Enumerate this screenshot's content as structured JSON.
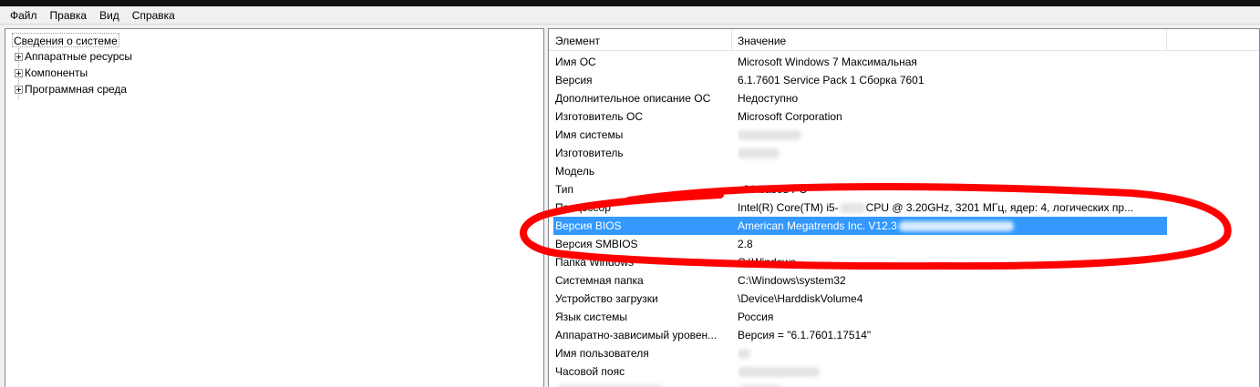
{
  "menu": {
    "file": "Файл",
    "edit": "Правка",
    "view": "Вид",
    "help": "Справка"
  },
  "tree": {
    "root": "Сведения о системе",
    "children": [
      "Аппаратные ресурсы",
      "Компоненты",
      "Программная среда"
    ]
  },
  "list": {
    "headers": {
      "item": "Элемент",
      "value": "Значение"
    },
    "rows": [
      {
        "item": "Имя ОС",
        "value": "Microsoft Windows 7 Максимальная"
      },
      {
        "item": "Версия",
        "value": "6.1.7601 Service Pack 1 Сборка 7601"
      },
      {
        "item": "Дополнительное описание ОС",
        "value": "Недоступно"
      },
      {
        "item": "Изготовитель ОС",
        "value": "Microsoft Corporation"
      },
      {
        "item": "Имя системы",
        "value": ""
      },
      {
        "item": "Изготовитель",
        "value": ""
      },
      {
        "item": "Модель",
        "value": ""
      },
      {
        "item": "Тип",
        "value": "x64-based PC"
      },
      {
        "item": "Процессор",
        "value": "Intel(R) Core(TM) i5-",
        "value_rest": "CPU @ 3.20GHz, 3201 МГц, ядер: 4, логических пр..."
      },
      {
        "item": "Версия BIOS",
        "value": "American Megatrends Inc. V12.3"
      },
      {
        "item": "Версия SMBIOS",
        "value": "2.8"
      },
      {
        "item": "Папка Windows",
        "value": "C:\\Windows"
      },
      {
        "item": "Системная папка",
        "value": "C:\\Windows\\system32"
      },
      {
        "item": "Устройство загрузки",
        "value": "\\Device\\HarddiskVolume4"
      },
      {
        "item": "Язык системы",
        "value": "Россия"
      },
      {
        "item": "Аппаратно-зависимый уровен...",
        "value": "Версия = \"6.1.7601.17514\""
      },
      {
        "item": "Имя пользователя",
        "value": ""
      },
      {
        "item": "Часовой пояс",
        "value": ""
      }
    ],
    "selected_row": "Версия BIOS"
  },
  "colors": {
    "selection": "#3399ff",
    "annotation": "#ff0000"
  },
  "icons": [
    "tree-expand-icon"
  ]
}
